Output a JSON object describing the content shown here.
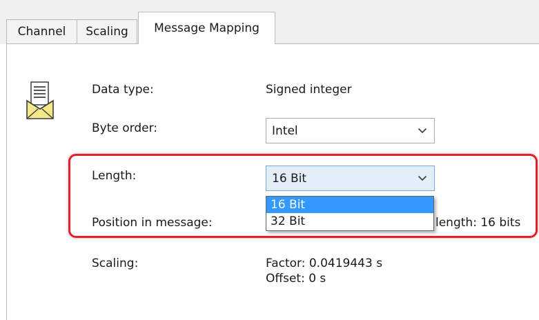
{
  "tabs": [
    {
      "label": "Channel",
      "active": false
    },
    {
      "label": "Scaling",
      "active": false
    },
    {
      "label": "Message Mapping",
      "active": true
    }
  ],
  "icon": "envelope-document-icon",
  "fields": {
    "data_type": {
      "label": "Data type:",
      "value": "Signed integer"
    },
    "byte_order": {
      "label": "Byte order:",
      "value": "Intel"
    },
    "length": {
      "label": "Length:",
      "value": "16 Bit",
      "options": [
        "16 Bit",
        "32 Bit"
      ],
      "selected_option": "16 Bit"
    },
    "position": {
      "label": "Position in message:",
      "value_partial": "length: 16 bits"
    },
    "scaling": {
      "label": "Scaling:",
      "factor": "Factor: 0.0419443 s",
      "offset": "Offset: 0 s"
    }
  },
  "colors": {
    "highlight_border": "#e2202a",
    "selected_option": "#3399ff",
    "focused_combo": "#e4eef9"
  }
}
